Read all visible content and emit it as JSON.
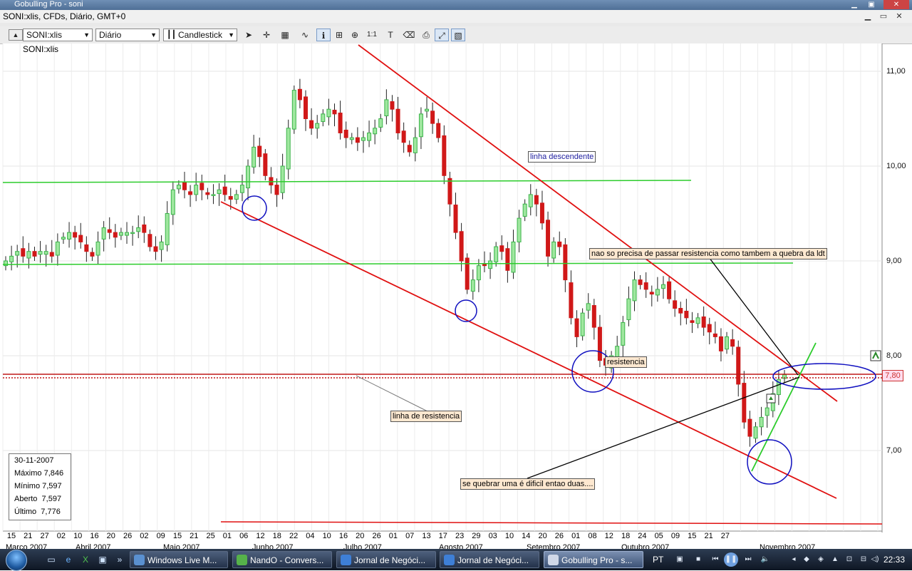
{
  "window": {
    "title": "Gobulling Pro - soni",
    "chart_title": "SONI:xlis, CFDs, Diário, GMT+0"
  },
  "toolbar": {
    "symbol": "SONI:xlis",
    "period": "Diário",
    "chart_type": "Candlestick"
  },
  "chart_label": "SONI:xlis",
  "info_box": [
    {
      "label": "30-11-2007",
      "value": ""
    },
    {
      "label": "Máximo",
      "value": "7,846"
    },
    {
      "label": "Mínimo",
      "value": "7,597"
    },
    {
      "label": "Aberto",
      "value": "7,597"
    },
    {
      "label": "Último",
      "value": "7,776"
    }
  ],
  "price_badge": "7,80",
  "y_axis": [
    "11,00",
    "10,00",
    "9,00",
    "8,00",
    "7,00"
  ],
  "x_days": [
    "15",
    "21",
    "27",
    "02",
    "10",
    "16",
    "20",
    "26",
    "02",
    "09",
    "15",
    "21",
    "25",
    "01",
    "06",
    "12",
    "18",
    "22",
    "04",
    "10",
    "16",
    "20",
    "26",
    "01",
    "07",
    "13",
    "17",
    "23",
    "29",
    "03",
    "10",
    "14",
    "20",
    "26",
    "01",
    "08",
    "12",
    "18",
    "24",
    "05",
    "09",
    "15",
    "21",
    "27"
  ],
  "x_months": [
    "Março 2007",
    "Abril 2007",
    "Maio 2007",
    "Junho 2007",
    "Julho 2007",
    "Agosto 2007",
    "Setembro 2007",
    "Outubro 2007",
    "Novembro 2007"
  ],
  "annotations": {
    "linha_descendente": "linha descendente",
    "resistencia_note": "nao so precisa de passar resistencia como tambem a quebra da ldt",
    "resistencia": "resistencia",
    "linha_resistencia": "linha de resistencia",
    "quebrar": "se quebrar uma é dificil entao duas...."
  },
  "taskbar": {
    "items": [
      "Windows Live M...",
      "NandO - Convers...",
      "Jornal de Negóci...",
      "Jornal de Negóci...",
      "Gobulling Pro - s..."
    ],
    "lang": "PT",
    "clock": "22:33"
  },
  "colors": {
    "up_candle": "#3cb44b",
    "down_candle": "#d01818",
    "trend_red": "#e01010",
    "trend_green": "#2ccc2c",
    "circles": "#1010c0"
  },
  "chart_data": {
    "type": "candlestick",
    "title": "SONI:xlis, CFDs, Diário, GMT+0",
    "ylim": [
      6.3,
      11.3
    ],
    "y_ticks": [
      7.0,
      8.0,
      9.0,
      10.0,
      11.0
    ],
    "current_price": 7.8,
    "last_bar": {
      "date": "30-11-2007",
      "high": 7.846,
      "low": 7.597,
      "open": 7.597,
      "close": 7.776
    },
    "close_series": [
      9.0,
      9.05,
      9.1,
      9.05,
      9.1,
      9.05,
      9.1,
      9.1,
      9.05,
      9.2,
      9.25,
      9.3,
      9.25,
      9.2,
      9.1,
      9.05,
      9.2,
      9.35,
      9.3,
      9.25,
      9.3,
      9.3,
      9.3,
      9.35,
      9.3,
      9.15,
      9.1,
      9.2,
      9.5,
      9.75,
      9.8,
      9.75,
      9.7,
      9.8,
      9.75,
      9.7,
      9.7,
      9.75,
      9.7,
      9.65,
      9.7,
      9.8,
      10.0,
      10.2,
      10.1,
      9.9,
      9.8,
      9.7,
      10.0,
      10.4,
      10.8,
      10.7,
      10.5,
      10.4,
      10.45,
      10.55,
      10.6,
      10.55,
      10.35,
      10.3,
      10.3,
      10.25,
      10.3,
      10.35,
      10.4,
      10.5,
      10.7,
      10.6,
      10.35,
      10.25,
      10.15,
      10.3,
      10.55,
      10.6,
      10.45,
      10.3,
      9.9,
      9.6,
      9.3,
      9.0,
      8.7,
      8.8,
      8.95,
      8.95,
      9.0,
      9.15,
      9.1,
      8.9,
      9.2,
      9.45,
      9.6,
      9.7,
      9.6,
      9.4,
      9.05,
      9.2,
      9.15,
      8.8,
      8.4,
      8.2,
      8.45,
      8.55,
      8.3,
      7.95,
      7.9,
      8.0,
      8.1,
      8.35,
      8.6,
      8.8,
      8.75,
      8.7,
      8.65,
      8.7,
      8.75,
      8.6,
      8.5,
      8.45,
      8.4,
      8.35,
      8.4,
      8.3,
      8.25,
      8.2,
      8.05,
      8.2,
      8.1,
      7.7,
      7.3,
      7.15,
      7.25,
      7.35,
      7.45,
      7.6,
      7.75,
      7.8
    ]
  }
}
